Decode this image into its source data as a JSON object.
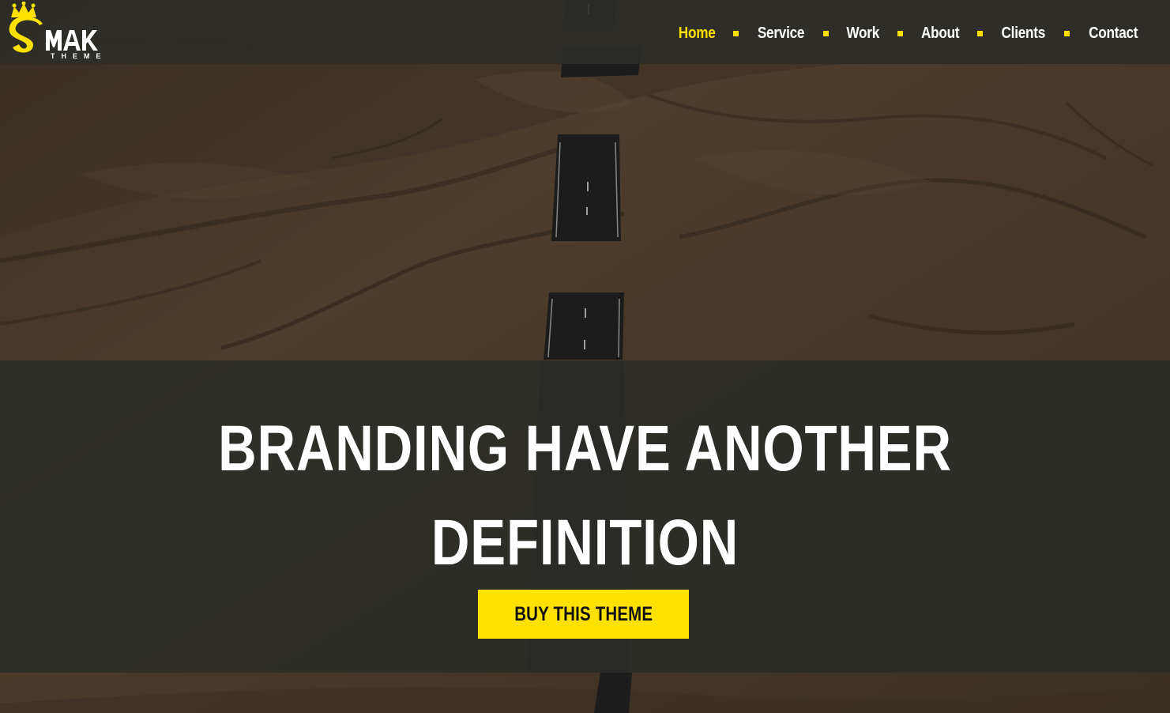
{
  "logo": {
    "wordmark": "SMAK",
    "tagline": "THEME"
  },
  "nav": {
    "items": [
      {
        "label": "Home",
        "active": true
      },
      {
        "label": "Service",
        "active": false
      },
      {
        "label": "Work",
        "active": false
      },
      {
        "label": "About",
        "active": false
      },
      {
        "label": "Clients",
        "active": false
      },
      {
        "label": "Contact",
        "active": false
      }
    ]
  },
  "hero": {
    "title": "BRANDING HAVE ANOTHER DEFINITION",
    "cta_label": "BUY THIS THEME",
    "background_image": "desert-road-aerial-photo"
  },
  "colors": {
    "accent": "#ffe100",
    "header_bg": "#2c2c28",
    "overlay": "#2a2c28",
    "text": "#ffffff",
    "sand": "#5a4630"
  }
}
